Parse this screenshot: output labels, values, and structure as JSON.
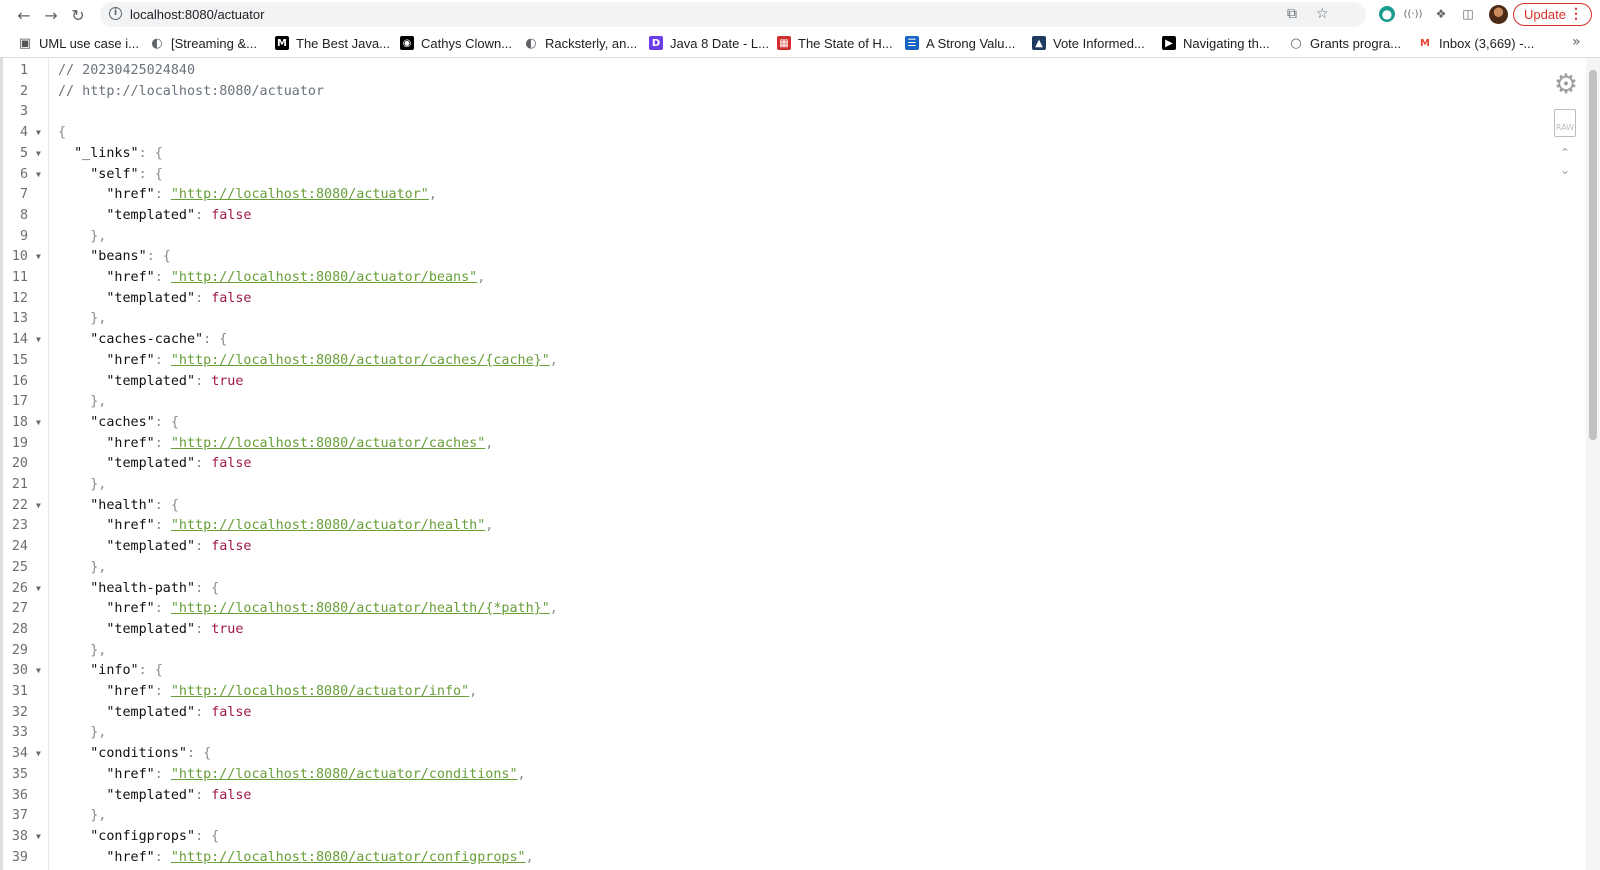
{
  "browser": {
    "url": "localhost:8080/actuator",
    "update_label": "Update",
    "icons": {
      "back": "arrow-left-icon",
      "forward": "arrow-right-icon",
      "reload": "reload-icon",
      "share": "share-icon",
      "star": "star-icon",
      "extensions": "puzzle-icon"
    }
  },
  "bookmarks": [
    {
      "label": "UML use case i...",
      "icon": "uml-icon",
      "color": "#555555"
    },
    {
      "label": "[Streaming &...",
      "icon": "globe-icon",
      "color": "#5f6368"
    },
    {
      "label": "The Best Java...",
      "icon": "medium-icon",
      "color": "#000000"
    },
    {
      "label": "Cathys Clown...",
      "icon": "site-icon",
      "color": "#000000"
    },
    {
      "label": "Racksterly, an...",
      "icon": "globe-icon",
      "color": "#5f6368"
    },
    {
      "label": "Java 8 Date - L...",
      "icon": "d-logo-icon",
      "color": "#6a3de8"
    },
    {
      "label": "The State of H...",
      "icon": "red-book-icon",
      "color": "#d32f2f"
    },
    {
      "label": "A Strong Valu...",
      "icon": "list-icon",
      "color": "#1565c0"
    },
    {
      "label": "Vote Informed...",
      "icon": "ballot-icon",
      "color": "#1f3a5f"
    },
    {
      "label": "Navigating th...",
      "icon": "media-icon",
      "color": "#000000"
    },
    {
      "label": "Grants progra...",
      "icon": "grants-icon",
      "color": "#5f6368"
    },
    {
      "label": "Inbox (3,669) -...",
      "icon": "gmail-icon",
      "color": "#ea4335"
    }
  ],
  "json_viewer": {
    "lines": [
      {
        "n": "1",
        "fold": false,
        "parts": [
          {
            "t": "// 20230425024840",
            "c": "cm"
          }
        ]
      },
      {
        "n": "2",
        "fold": false,
        "parts": [
          {
            "t": "// http://localhost:8080/actuator",
            "c": "cm"
          }
        ]
      },
      {
        "n": "3",
        "fold": false,
        "parts": []
      },
      {
        "n": "4",
        "fold": true,
        "parts": [
          {
            "t": "{",
            "c": "p"
          }
        ]
      },
      {
        "n": "5",
        "fold": true,
        "parts": [
          {
            "t": "  \"_links\"",
            "c": "key"
          },
          {
            "t": ": {",
            "c": "p"
          }
        ]
      },
      {
        "n": "6",
        "fold": true,
        "parts": [
          {
            "t": "    \"self\"",
            "c": "key"
          },
          {
            "t": ": {",
            "c": "p"
          }
        ]
      },
      {
        "n": "7",
        "fold": false,
        "parts": [
          {
            "t": "      \"href\"",
            "c": "key"
          },
          {
            "t": ": ",
            "c": "p"
          },
          {
            "t": "\"http://localhost:8080/actuator\"",
            "c": "str"
          },
          {
            "t": ",",
            "c": "p"
          }
        ]
      },
      {
        "n": "8",
        "fold": false,
        "parts": [
          {
            "t": "      \"templated\"",
            "c": "key"
          },
          {
            "t": ": ",
            "c": "p"
          },
          {
            "t": "false",
            "c": "bool"
          }
        ]
      },
      {
        "n": "9",
        "fold": false,
        "parts": [
          {
            "t": "    },",
            "c": "p"
          }
        ]
      },
      {
        "n": "10",
        "fold": true,
        "parts": [
          {
            "t": "    \"beans\"",
            "c": "key"
          },
          {
            "t": ": {",
            "c": "p"
          }
        ]
      },
      {
        "n": "11",
        "fold": false,
        "parts": [
          {
            "t": "      \"href\"",
            "c": "key"
          },
          {
            "t": ": ",
            "c": "p"
          },
          {
            "t": "\"http://localhost:8080/actuator/beans\"",
            "c": "str"
          },
          {
            "t": ",",
            "c": "p"
          }
        ]
      },
      {
        "n": "12",
        "fold": false,
        "parts": [
          {
            "t": "      \"templated\"",
            "c": "key"
          },
          {
            "t": ": ",
            "c": "p"
          },
          {
            "t": "false",
            "c": "bool"
          }
        ]
      },
      {
        "n": "13",
        "fold": false,
        "parts": [
          {
            "t": "    },",
            "c": "p"
          }
        ]
      },
      {
        "n": "14",
        "fold": true,
        "parts": [
          {
            "t": "    \"caches-cache\"",
            "c": "key"
          },
          {
            "t": ": {",
            "c": "p"
          }
        ]
      },
      {
        "n": "15",
        "fold": false,
        "parts": [
          {
            "t": "      \"href\"",
            "c": "key"
          },
          {
            "t": ": ",
            "c": "p"
          },
          {
            "t": "\"http://localhost:8080/actuator/caches/{cache}\"",
            "c": "str"
          },
          {
            "t": ",",
            "c": "p"
          }
        ]
      },
      {
        "n": "16",
        "fold": false,
        "parts": [
          {
            "t": "      \"templated\"",
            "c": "key"
          },
          {
            "t": ": ",
            "c": "p"
          },
          {
            "t": "true",
            "c": "bool"
          }
        ]
      },
      {
        "n": "17",
        "fold": false,
        "parts": [
          {
            "t": "    },",
            "c": "p"
          }
        ]
      },
      {
        "n": "18",
        "fold": true,
        "parts": [
          {
            "t": "    \"caches\"",
            "c": "key"
          },
          {
            "t": ": {",
            "c": "p"
          }
        ]
      },
      {
        "n": "19",
        "fold": false,
        "parts": [
          {
            "t": "      \"href\"",
            "c": "key"
          },
          {
            "t": ": ",
            "c": "p"
          },
          {
            "t": "\"http://localhost:8080/actuator/caches\"",
            "c": "str"
          },
          {
            "t": ",",
            "c": "p"
          }
        ]
      },
      {
        "n": "20",
        "fold": false,
        "parts": [
          {
            "t": "      \"templated\"",
            "c": "key"
          },
          {
            "t": ": ",
            "c": "p"
          },
          {
            "t": "false",
            "c": "bool"
          }
        ]
      },
      {
        "n": "21",
        "fold": false,
        "parts": [
          {
            "t": "    },",
            "c": "p"
          }
        ]
      },
      {
        "n": "22",
        "fold": true,
        "parts": [
          {
            "t": "    \"health\"",
            "c": "key"
          },
          {
            "t": ": {",
            "c": "p"
          }
        ]
      },
      {
        "n": "23",
        "fold": false,
        "parts": [
          {
            "t": "      \"href\"",
            "c": "key"
          },
          {
            "t": ": ",
            "c": "p"
          },
          {
            "t": "\"http://localhost:8080/actuator/health\"",
            "c": "str"
          },
          {
            "t": ",",
            "c": "p"
          }
        ]
      },
      {
        "n": "24",
        "fold": false,
        "parts": [
          {
            "t": "      \"templated\"",
            "c": "key"
          },
          {
            "t": ": ",
            "c": "p"
          },
          {
            "t": "false",
            "c": "bool"
          }
        ]
      },
      {
        "n": "25",
        "fold": false,
        "parts": [
          {
            "t": "    },",
            "c": "p"
          }
        ]
      },
      {
        "n": "26",
        "fold": true,
        "parts": [
          {
            "t": "    \"health-path\"",
            "c": "key"
          },
          {
            "t": ": {",
            "c": "p"
          }
        ]
      },
      {
        "n": "27",
        "fold": false,
        "parts": [
          {
            "t": "      \"href\"",
            "c": "key"
          },
          {
            "t": ": ",
            "c": "p"
          },
          {
            "t": "\"http://localhost:8080/actuator/health/{*path}\"",
            "c": "str"
          },
          {
            "t": ",",
            "c": "p"
          }
        ]
      },
      {
        "n": "28",
        "fold": false,
        "parts": [
          {
            "t": "      \"templated\"",
            "c": "key"
          },
          {
            "t": ": ",
            "c": "p"
          },
          {
            "t": "true",
            "c": "bool"
          }
        ]
      },
      {
        "n": "29",
        "fold": false,
        "parts": [
          {
            "t": "    },",
            "c": "p"
          }
        ]
      },
      {
        "n": "30",
        "fold": true,
        "parts": [
          {
            "t": "    \"info\"",
            "c": "key"
          },
          {
            "t": ": {",
            "c": "p"
          }
        ]
      },
      {
        "n": "31",
        "fold": false,
        "parts": [
          {
            "t": "      \"href\"",
            "c": "key"
          },
          {
            "t": ": ",
            "c": "p"
          },
          {
            "t": "\"http://localhost:8080/actuator/info\"",
            "c": "str"
          },
          {
            "t": ",",
            "c": "p"
          }
        ]
      },
      {
        "n": "32",
        "fold": false,
        "parts": [
          {
            "t": "      \"templated\"",
            "c": "key"
          },
          {
            "t": ": ",
            "c": "p"
          },
          {
            "t": "false",
            "c": "bool"
          }
        ]
      },
      {
        "n": "33",
        "fold": false,
        "parts": [
          {
            "t": "    },",
            "c": "p"
          }
        ]
      },
      {
        "n": "34",
        "fold": true,
        "parts": [
          {
            "t": "    \"conditions\"",
            "c": "key"
          },
          {
            "t": ": {",
            "c": "p"
          }
        ]
      },
      {
        "n": "35",
        "fold": false,
        "parts": [
          {
            "t": "      \"href\"",
            "c": "key"
          },
          {
            "t": ": ",
            "c": "p"
          },
          {
            "t": "\"http://localhost:8080/actuator/conditions\"",
            "c": "str"
          },
          {
            "t": ",",
            "c": "p"
          }
        ]
      },
      {
        "n": "36",
        "fold": false,
        "parts": [
          {
            "t": "      \"templated\"",
            "c": "key"
          },
          {
            "t": ": ",
            "c": "p"
          },
          {
            "t": "false",
            "c": "bool"
          }
        ]
      },
      {
        "n": "37",
        "fold": false,
        "parts": [
          {
            "t": "    },",
            "c": "p"
          }
        ]
      },
      {
        "n": "38",
        "fold": true,
        "parts": [
          {
            "t": "    \"configprops\"",
            "c": "key"
          },
          {
            "t": ": {",
            "c": "p"
          }
        ]
      },
      {
        "n": "39",
        "fold": false,
        "parts": [
          {
            "t": "      \"href\"",
            "c": "key"
          },
          {
            "t": ": ",
            "c": "p"
          },
          {
            "t": "\"http://localhost:8080/actuator/configprops\"",
            "c": "str"
          },
          {
            "t": ",",
            "c": "p"
          }
        ]
      }
    ],
    "tools": {
      "settings": "gear-icon",
      "raw_label": "RAW",
      "raw": "raw-file-icon",
      "up": "chevron-up-icon",
      "down": "chevron-down-icon"
    }
  }
}
